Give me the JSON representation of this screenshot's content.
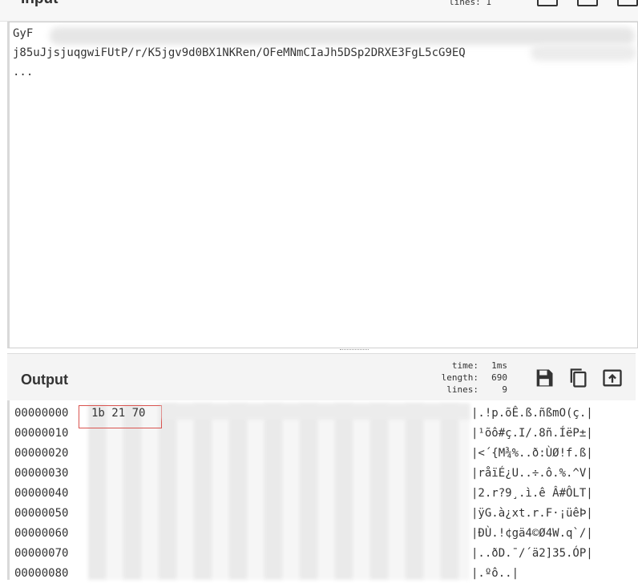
{
  "input": {
    "title": "Input",
    "stats_label": "lines:",
    "stats_value": "1",
    "lines": [
      "GyF",
      "j85uJjsjuqgwiFUtP/r/K5jgv9d0BX1NKRen/OFeMNmCIaJh5DSp2DRXE3FgL5cG9EQ",
      "..."
    ]
  },
  "output": {
    "title": "Output",
    "stats": [
      {
        "key": "time:",
        "value": "1ms"
      },
      {
        "key": "length:",
        "value": "690"
      },
      {
        "key": "lines:",
        "value": "9"
      }
    ],
    "icons": [
      "save-icon",
      "copy-icon",
      "replace-input-icon"
    ],
    "rows": [
      {
        "offset": "00000000",
        "bytes": "1b 21 70",
        "ascii": "|.!p.õÊ.ß.ñßmO(ç.|"
      },
      {
        "offset": "00000010",
        "bytes": "",
        "ascii": "|¹õô#ç.I/.8ñ.ÍëP±|"
      },
      {
        "offset": "00000020",
        "bytes": "",
        "ascii": "|<´{M¾%..ð:ÙØ!f.ß|"
      },
      {
        "offset": "00000030",
        "bytes": "",
        "ascii": "|råïÉ¿U..÷.ô.%.^V|"
      },
      {
        "offset": "00000040",
        "bytes": "",
        "ascii": "|2.r?9¸.ì.ê Â#ÔLT|"
      },
      {
        "offset": "00000050",
        "bytes": "",
        "ascii": "|ÿG.à¿xt.r.F·¡üêÞ|"
      },
      {
        "offset": "00000060",
        "bytes": "",
        "ascii": "|ÐÙ.!¢gä4©Ø4W.q`/|"
      },
      {
        "offset": "00000070",
        "bytes": "",
        "ascii": "|..ðD.¯/´ä2]35.ÓP|"
      },
      {
        "offset": "00000080",
        "bytes": "",
        "ascii": "|.ºô..|"
      }
    ]
  }
}
